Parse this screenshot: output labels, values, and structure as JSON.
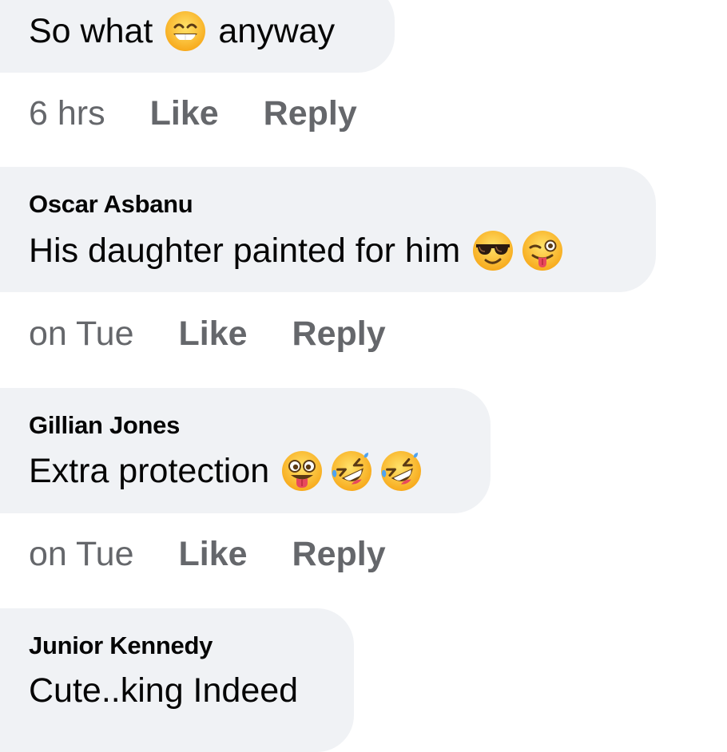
{
  "comments": [
    {
      "author": "",
      "text": "So what",
      "text_after": "anyway",
      "emojis": [
        "grinning-face-icon"
      ],
      "time": "6 hrs",
      "like_label": "Like",
      "reply_label": "Reply"
    },
    {
      "author": "Oscar Asbanu",
      "text": "His daughter painted for him",
      "emojis": [
        "smiling-face-with-sunglasses-icon",
        "winking-face-with-tongue-icon"
      ],
      "time": "on Tue",
      "like_label": "Like",
      "reply_label": "Reply"
    },
    {
      "author": "Gillian Jones",
      "text": "Extra protection",
      "emojis": [
        "zany-face-icon",
        "rolling-on-floor-laughing-icon",
        "rolling-on-floor-laughing-icon"
      ],
      "time": "on Tue",
      "like_label": "Like",
      "reply_label": "Reply"
    },
    {
      "author": "Junior Kennedy",
      "text": "Cute..king Indeed",
      "emojis": []
    }
  ],
  "colors": {
    "bubble_bg": "#f0f2f5",
    "text": "#050505",
    "meta": "#65676b",
    "emoji_yellow": "#ffc83d"
  }
}
